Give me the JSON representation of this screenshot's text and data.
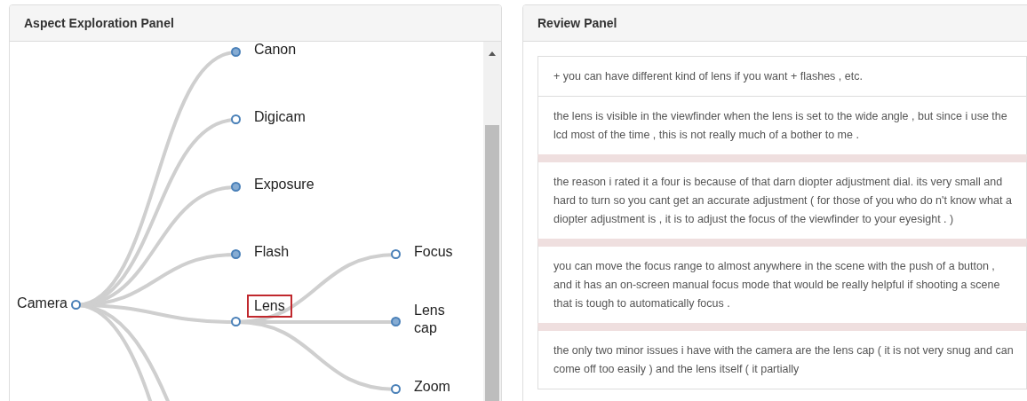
{
  "aspect_panel": {
    "title": "Aspect Exploration Panel",
    "tree": {
      "label": "Camera",
      "collapsed": false,
      "selected": false,
      "children": [
        {
          "label": "Canon",
          "collapsed": true,
          "selected": false
        },
        {
          "label": "Digicam",
          "collapsed": false,
          "selected": false
        },
        {
          "label": "Exposure",
          "collapsed": true,
          "selected": false
        },
        {
          "label": "Flash",
          "collapsed": true,
          "selected": false
        },
        {
          "label": "Lens",
          "collapsed": false,
          "selected": true,
          "children": [
            {
              "label": "Focus",
              "collapsed": false,
              "selected": false
            },
            {
              "label": "Lens cap",
              "collapsed": true,
              "selected": false
            },
            {
              "label": "Zoom",
              "collapsed": false,
              "selected": false
            }
          ]
        }
      ]
    }
  },
  "review_panel": {
    "title": "Review Panel",
    "reviews": [
      "+ you can have different kind of lens if you want + flashes , etc.",
      "the lens is visible in the viewfinder when the lens is set to the wide angle , but since i use the lcd most of the time , this is not really much of a bother to me .",
      "the reason i rated it a four is because of that darn diopter adjustment dial. its very small and hard to turn so you cant get an accurate adjustment ( for those of you who do n't know what a diopter adjustment is , it is to adjust the focus of the viewfinder to your eyesight . )",
      "you can move the focus range to almost anywhere in the scene with the push of a button , and it has an on-screen manual focus mode that would be really helpful if shooting a scene that is tough to automatically focus .",
      "the only two minor issues i have with the camera are the lens cap ( it is not very snug and can come off too easily ) and the lens itself ( it partially"
    ]
  }
}
